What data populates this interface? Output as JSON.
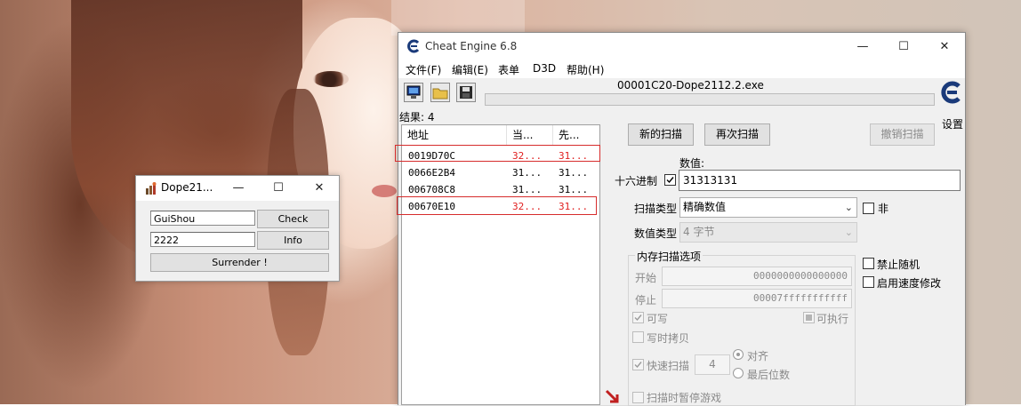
{
  "dope_window": {
    "title": "Dope21...",
    "name_value": "GuiShou",
    "key_value": "2222",
    "check_label": "Check",
    "info_label": "Info",
    "surrender_label": "Surrender !",
    "minimize": "—",
    "maximize": "☐",
    "close": "✕"
  },
  "ce_window": {
    "title": "Cheat Engine 6.8",
    "minimize": "—",
    "maximize": "☐",
    "close": "✕",
    "menu": [
      "文件(F)",
      "编辑(E)",
      "表单",
      "D3D",
      "帮助(H)"
    ],
    "process_name": "00001C20-Dope2112.2.exe",
    "settings_label": "设置",
    "results_label": "结果: 4",
    "list_headers": [
      "地址",
      "当...",
      "先..."
    ],
    "rows": [
      {
        "address": "0019D70C",
        "current": "32...",
        "previous": "31...",
        "changed": true
      },
      {
        "address": "0066E2B4",
        "current": "31...",
        "previous": "31...",
        "changed": false
      },
      {
        "address": "006708C8",
        "current": "31...",
        "previous": "31...",
        "changed": false
      },
      {
        "address": "00670E10",
        "current": "32...",
        "previous": "31...",
        "changed": true
      }
    ],
    "new_scan": "新的扫描",
    "next_scan": "再次扫描",
    "undo_scan": "撤销扫描",
    "value_label": "数值:",
    "hex_label": "十六进制",
    "value_input": "31313131",
    "scan_type_label": "扫描类型",
    "scan_type_value": "精确数值",
    "not_label": "非",
    "value_type_label": "数值类型",
    "value_type_value": "4 字节",
    "memory_options_label": "内存扫描选项",
    "start_label": "开始",
    "start_value": "0000000000000000",
    "stop_label": "停止",
    "stop_value": "00007fffffffffff",
    "writable_label": "可写",
    "executable_label": "可执行",
    "copy_on_write_label": "写时拷贝",
    "fast_scan_label": "快速扫描",
    "fast_scan_value": "4",
    "alignment_label": "对齐",
    "last_digits_label": "最后位数",
    "pause_game_label": "扫描时暂停游戏",
    "disable_random_label": "禁止随机",
    "speedhack_label": "启用速度修改"
  },
  "colors": {
    "changed_value": "#e02020",
    "highlight_box": "#d62c2c"
  }
}
